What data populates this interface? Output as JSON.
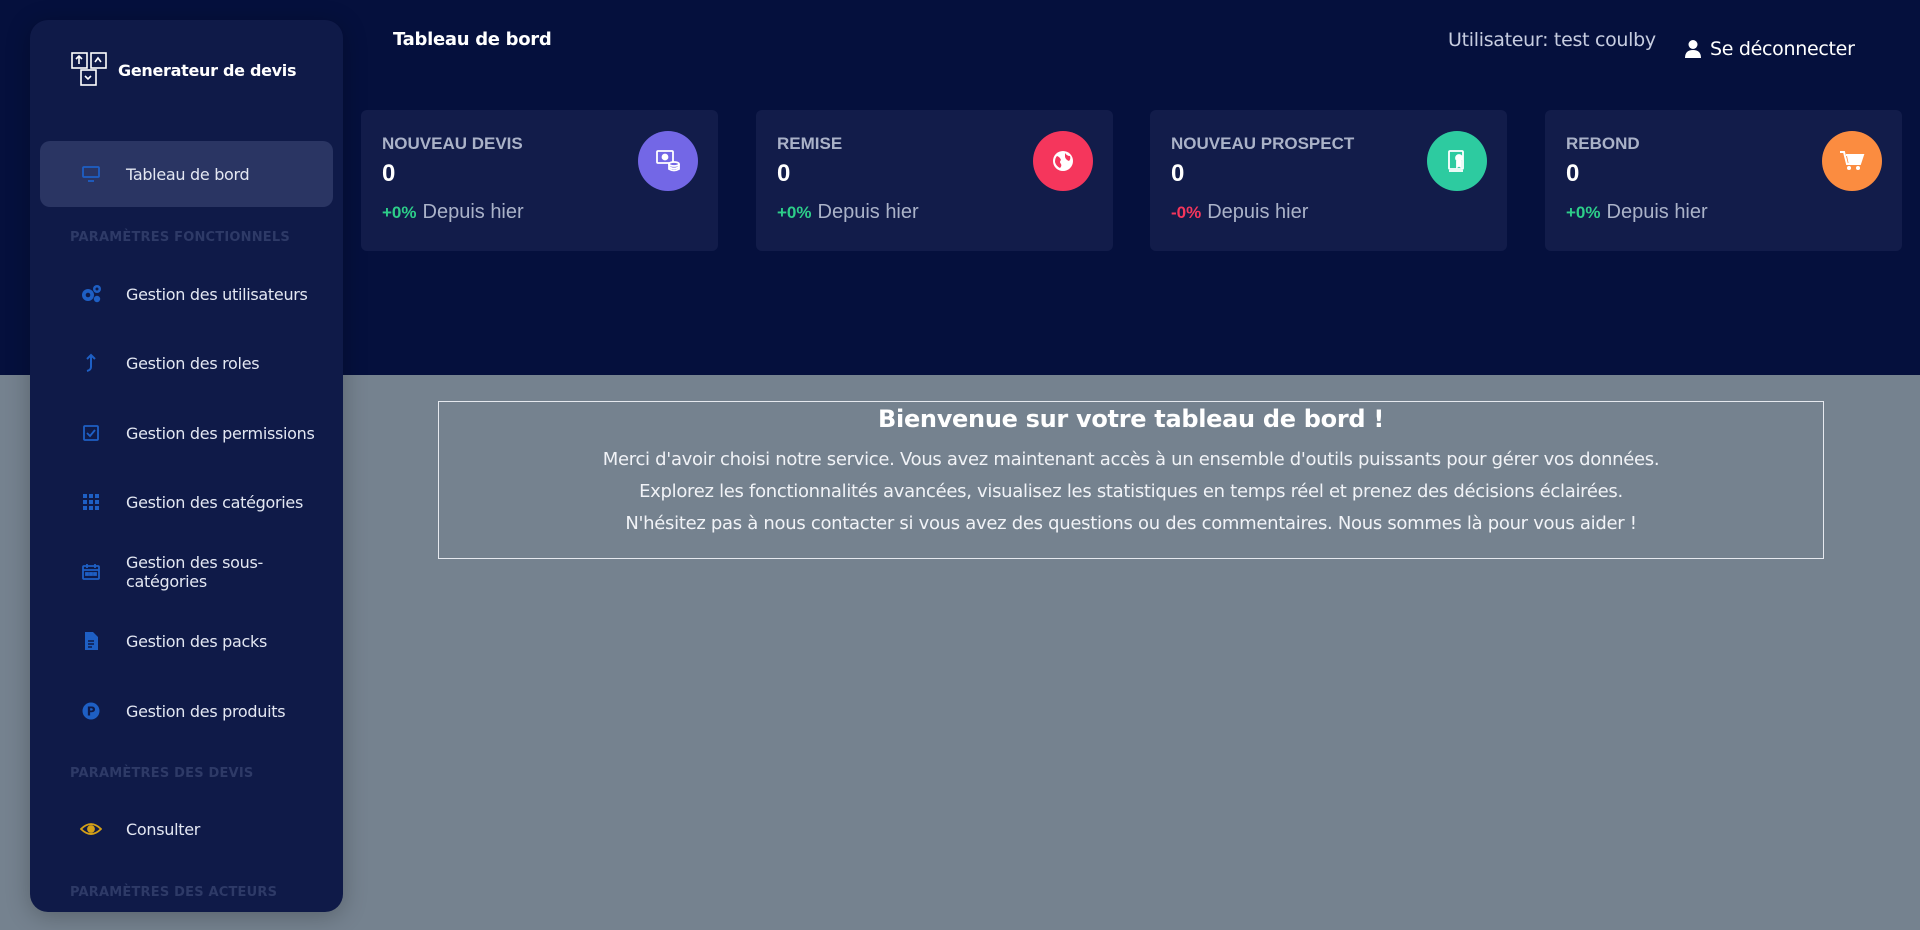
{
  "app": {
    "brand": "Generateur de devis"
  },
  "header": {
    "title": "Tableau de bord",
    "user": "Utilisateur: test coulby",
    "logout": "Se déconnecter"
  },
  "sidebar": {
    "items": [
      {
        "label": "Tableau de bord",
        "icon": "monitor-icon"
      },
      {
        "label": "Gestion des utilisateurs",
        "icon": "cogs-icon"
      },
      {
        "label": "Gestion des roles",
        "icon": "arrow-up-icon"
      },
      {
        "label": "Gestion des permissions",
        "icon": "checkbox-icon"
      },
      {
        "label": "Gestion des catégories",
        "icon": "grid-icon"
      },
      {
        "label": "Gestion des sous-catégories",
        "icon": "calendar-icon"
      },
      {
        "label": "Gestion des packs",
        "icon": "document-icon"
      },
      {
        "label": "Gestion des produits",
        "icon": "product-icon"
      },
      {
        "label": "Consulter",
        "icon": "eye-icon"
      }
    ],
    "sections": [
      "PARAMÈTRES FONCTIONNELS",
      "PARAMÈTRES DES DEVIS",
      "PARAMÈTRES DES ACTEURS"
    ]
  },
  "stats": [
    {
      "label": "NOUVEAU DEVIS",
      "value": "0",
      "delta": "+0%",
      "delta_text": "Depuis hier",
      "trend": "up",
      "color": "#7367e6",
      "icon": "money-coins-icon"
    },
    {
      "label": "REMISE",
      "value": "0",
      "delta": "+0%",
      "delta_text": "Depuis hier",
      "trend": "up",
      "color": "#f5365c",
      "icon": "globe-icon"
    },
    {
      "label": "NOUVEAU PROSPECT",
      "value": "0",
      "delta": "-0%",
      "delta_text": "Depuis hier",
      "trend": "down",
      "color": "#2dce89",
      "icon": "paper-diploma-icon"
    },
    {
      "label": "REBOND",
      "value": "0",
      "delta": "+0%",
      "delta_text": "Depuis hier",
      "trend": "up",
      "color": "#fb8c40",
      "icon": "cart-icon"
    }
  ],
  "welcome": {
    "title": "Bienvenue sur votre tableau de bord !",
    "lines": [
      "Merci d'avoir choisi notre service. Vous avez maintenant accès à un ensemble d'outils puissants pour gérer vos données.",
      "Explorez les fonctionnalités avancées, visualisez les statistiques en temps réel et prenez des décisions éclairées.",
      "N'hésitez pas à nous contacter si vous avez des questions ou des commentaires. Nous sommes là pour vous aider !"
    ]
  }
}
